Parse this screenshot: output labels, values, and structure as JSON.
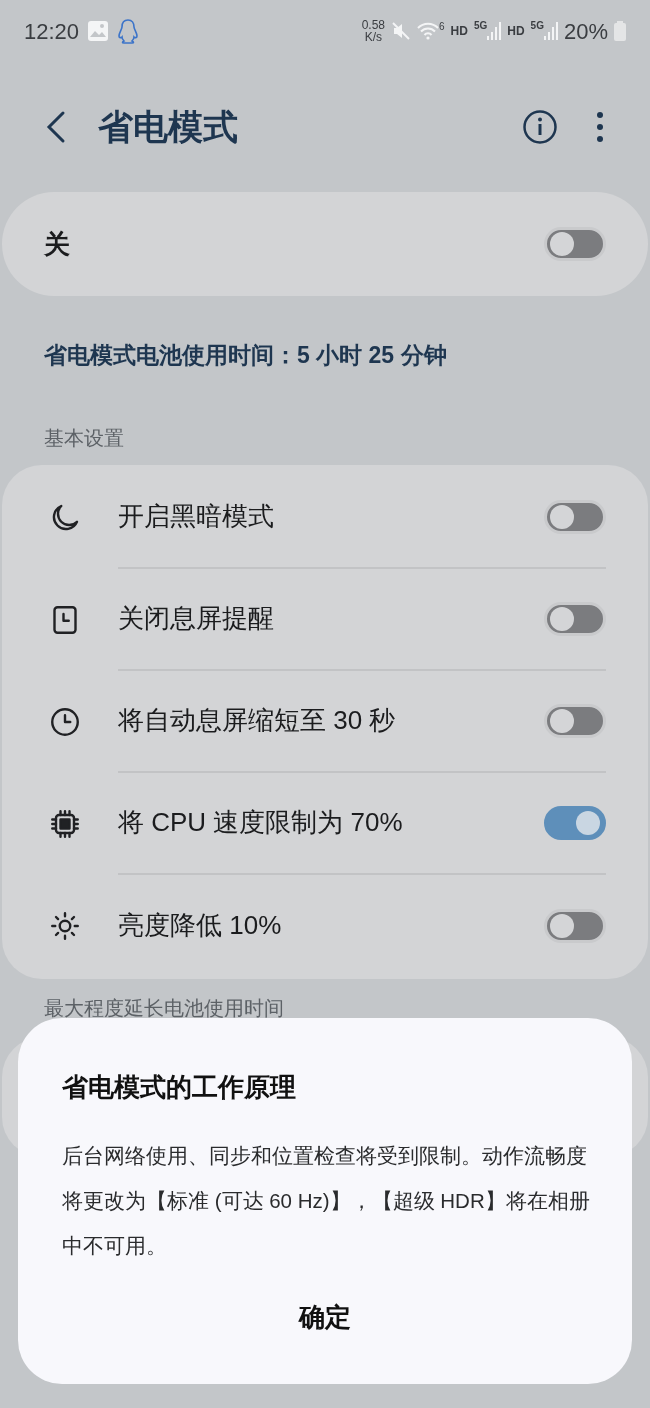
{
  "status_bar": {
    "time": "12:20",
    "net_speed": "0.58",
    "net_speed_unit": "K/s",
    "wifi_label": "6",
    "sim1_hd": "HD",
    "sim1_net": "5G",
    "sim2_hd": "HD",
    "sim2_net": "5G",
    "battery": "20%"
  },
  "header": {
    "title": "省电模式"
  },
  "master": {
    "label": "关",
    "on": false
  },
  "estimate": "省电模式电池使用时间：5 小时 25 分钟",
  "sections": [
    {
      "title": "基本设置",
      "items": [
        {
          "kind": "moon",
          "label": "开启黑暗模式",
          "on": false
        },
        {
          "kind": "aod",
          "label": "关闭息屏提醒",
          "on": false
        },
        {
          "kind": "clock",
          "label": "将自动息屏缩短至 30 秒",
          "on": false
        },
        {
          "kind": "chip",
          "label": "将 CPU 速度限制为 70%",
          "on": true
        },
        {
          "kind": "sun",
          "label": "亮度降低 10%",
          "on": false
        }
      ]
    },
    {
      "title": "最大程度延长电池使用时间"
    }
  ],
  "dialog": {
    "title": "省电模式的工作原理",
    "body": "后台网络使用、同步和位置检查将受到限制。动作流畅度将更改为【标准 (可达 60 Hz)】，【超级 HDR】将在相册中不可用。",
    "button": "确定"
  }
}
